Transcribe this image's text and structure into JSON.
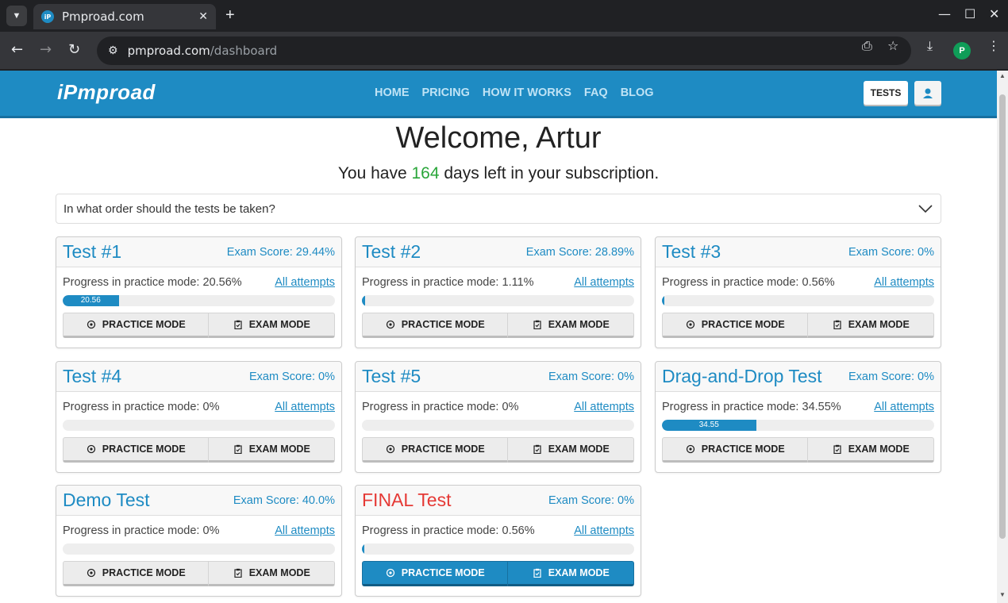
{
  "browser": {
    "tab_title": "Pmproad.com",
    "favicon_text": "iP",
    "url_host": "pmproad.com",
    "url_path": "/dashboard",
    "profile_initial": "P"
  },
  "site": {
    "logo": "iPmproad",
    "nav": [
      "HOME",
      "PRICING",
      "HOW IT WORKS",
      "FAQ",
      "BLOG"
    ],
    "tests_button": "TESTS",
    "accent_color": "#1e8bc3"
  },
  "welcome": {
    "title": "Welcome, Artur",
    "sub_before": "You have ",
    "days": "164",
    "sub_after": " days left in your subscription."
  },
  "faq": {
    "question": "In what order should the tests be taken?"
  },
  "labels": {
    "practice_prefix": "Progress in practice mode: ",
    "all_attempts": "All attempts",
    "practice_mode": "PRACTICE MODE",
    "exam_mode": "EXAM MODE"
  },
  "tests": [
    {
      "title": "Test #1",
      "exam_score": "Exam Score: 29.44%",
      "progress_text": "20.56%",
      "progress": 20.56,
      "bar_label": "20.56",
      "final": false
    },
    {
      "title": "Test #2",
      "exam_score": "Exam Score: 28.89%",
      "progress_text": "1.11%",
      "progress": 1.11,
      "bar_label": "",
      "final": false
    },
    {
      "title": "Test #3",
      "exam_score": "Exam Score: 0%",
      "progress_text": "0.56%",
      "progress": 0.56,
      "bar_label": "",
      "final": false
    },
    {
      "title": "Test #4",
      "exam_score": "Exam Score: 0%",
      "progress_text": "0%",
      "progress": 0,
      "bar_label": "",
      "final": false
    },
    {
      "title": "Test #5",
      "exam_score": "Exam Score: 0%",
      "progress_text": "0%",
      "progress": 0,
      "bar_label": "",
      "final": false
    },
    {
      "title": "Drag-and-Drop Test",
      "exam_score": "Exam Score: 0%",
      "progress_text": "34.55%",
      "progress": 34.55,
      "bar_label": "34.55",
      "final": false
    },
    {
      "title": "Demo Test",
      "exam_score": "Exam Score: 40.0%",
      "progress_text": "0%",
      "progress": 0,
      "bar_label": "",
      "final": false
    },
    {
      "title": "FINAL Test",
      "exam_score": "Exam Score: 0%",
      "progress_text": "0.56%",
      "progress": 0.56,
      "bar_label": "",
      "final": true
    }
  ]
}
